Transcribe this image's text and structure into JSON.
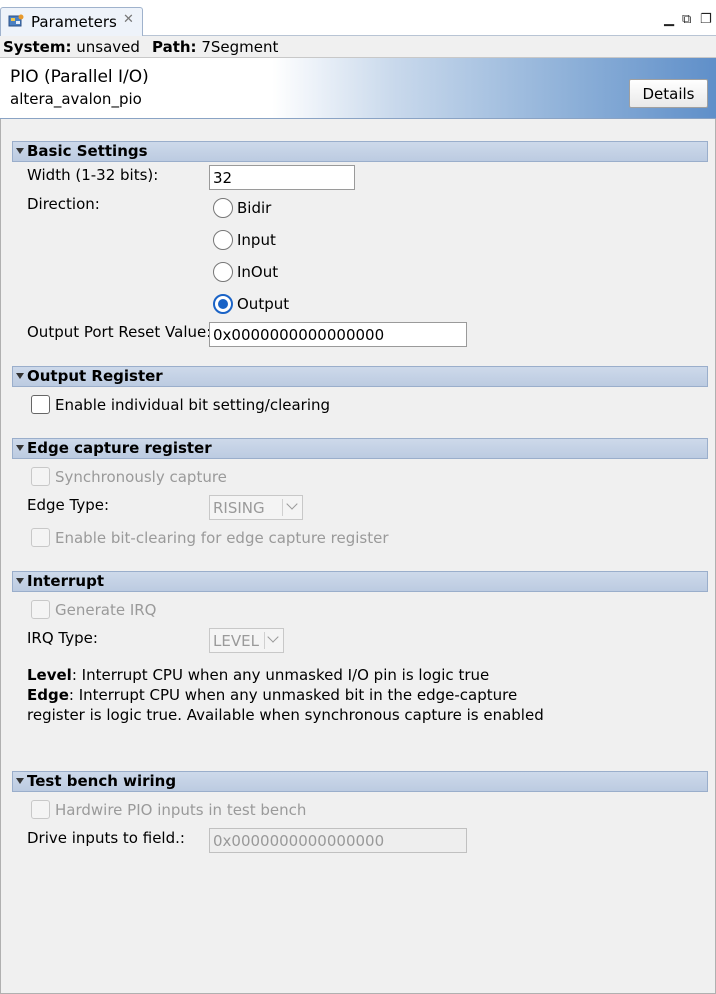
{
  "tab": {
    "label": "Parameters",
    "close": "✕"
  },
  "window_controls": {
    "minimize": "▁",
    "maximize": "⧉",
    "restore": "❐"
  },
  "pathbar": {
    "system_label": "System:",
    "system_value": "unsaved",
    "path_label": "Path:",
    "path_value": "7Segment"
  },
  "component": {
    "title": "PIO (Parallel I/O)",
    "subtitle": "altera_avalon_pio",
    "details_label": "Details"
  },
  "basic_settings": {
    "title": "Basic Settings",
    "width_label": "Width (1-32 bits):",
    "width_value": "32",
    "direction_label": "Direction:",
    "direction_options": [
      "Bidir",
      "Input",
      "InOut",
      "Output"
    ],
    "direction_selected": "Output",
    "reset_label": "Output Port Reset Value:",
    "reset_value": "0x0000000000000000"
  },
  "output_register": {
    "title": "Output Register",
    "bit_setting_label": "Enable individual bit setting/clearing",
    "bit_setting_checked": false
  },
  "edge_capture": {
    "title": "Edge capture register",
    "sync_capture_label": "Synchronously capture",
    "edge_type_label": "Edge Type:",
    "edge_type_value": "RISING",
    "bit_clearing_label": "Enable bit-clearing for edge capture register"
  },
  "interrupt": {
    "title": "Interrupt",
    "generate_irq_label": "Generate IRQ",
    "irq_type_label": "IRQ Type:",
    "irq_type_value": "LEVEL",
    "level_term": "Level",
    "level_desc": ": Interrupt CPU when any unmasked I/O pin is logic true",
    "edge_term": "Edge",
    "edge_desc": ": Interrupt CPU when any unmasked bit in the edge-capture",
    "edge_desc_2": "register is logic true. Available when synchronous capture is enabled"
  },
  "test_bench": {
    "title": "Test bench wiring",
    "hardwire_label": "Hardwire PIO inputs in test bench",
    "drive_label": "Drive inputs to field.:",
    "drive_value": "0x0000000000000000"
  },
  "colors": {
    "accent": "#1a63c6",
    "section_bg": "#c5d3e7",
    "banner_end": "#5f8fc9"
  },
  "icons": {
    "tab": "parameters-icon",
    "collapse": "triangle-down-icon"
  }
}
